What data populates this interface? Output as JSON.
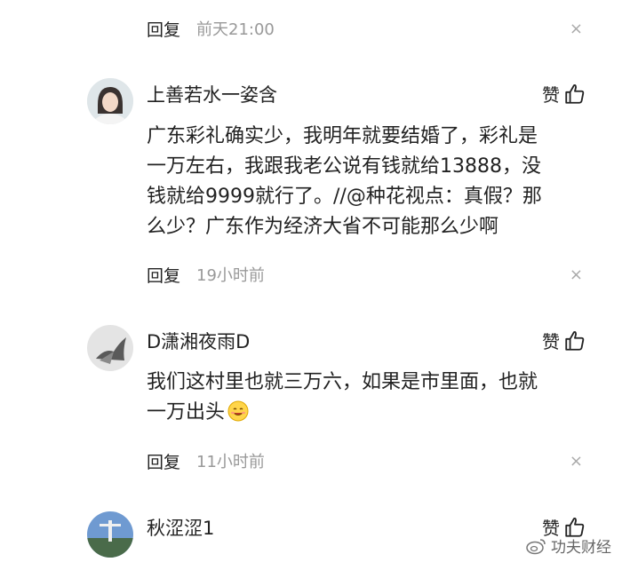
{
  "top_reply": {
    "reply_label": "回复",
    "time": "前天21:00"
  },
  "comments": [
    {
      "username": "上善若水一姿含",
      "like_label": "赞",
      "text_lines": [
        "广东彩礼确实少，我明年就要结婚了，彩礼是",
        "一万左右，我跟我老公说有钱就给13888，没",
        "钱就给9999就行了。//@种花视点：真假？那",
        "么少？广东作为经济大省不可能那么少啊"
      ],
      "reply_label": "回复",
      "time": "19小时前"
    },
    {
      "username": "D潇湘夜雨D",
      "like_label": "赞",
      "text_lines": [
        "我们这村里也就三万六，如果是市里面，也就",
        "一万出头"
      ],
      "emoji": "smiling-face-emoji",
      "reply_label": "回复",
      "time": "11小时前"
    },
    {
      "username": "秋涩涩1",
      "like_label": "赞"
    }
  ],
  "watermark": {
    "text": "功夫财经",
    "icon": "weibo-logo"
  },
  "close_symbol": "×"
}
